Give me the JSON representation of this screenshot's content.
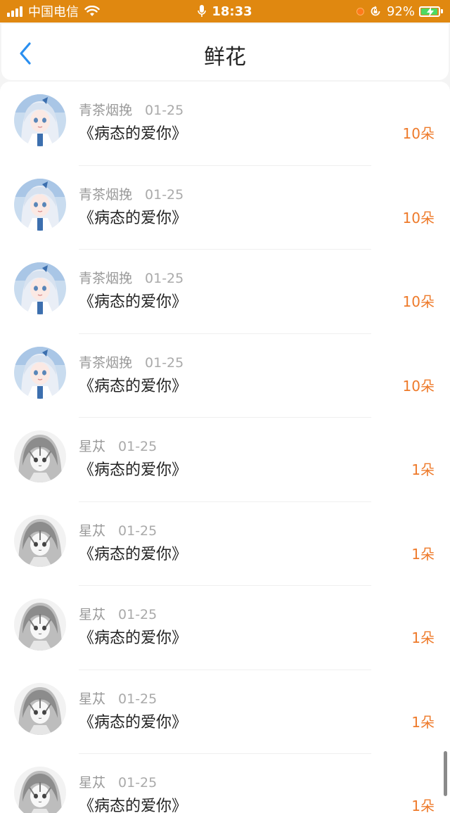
{
  "status_bar": {
    "carrier": "中国电信",
    "time": "18:33",
    "battery": "92%",
    "accent_color": "#e08810"
  },
  "header": {
    "title": "鲜花",
    "back_icon": "chevron-left-icon"
  },
  "items": [
    {
      "user": "青茶烟挽",
      "date": "01-25",
      "title": "《病态的爱你》",
      "amount": "10朵",
      "avatar": "blue-anime-avatar"
    },
    {
      "user": "青茶烟挽",
      "date": "01-25",
      "title": "《病态的爱你》",
      "amount": "10朵",
      "avatar": "blue-anime-avatar"
    },
    {
      "user": "青茶烟挽",
      "date": "01-25",
      "title": "《病态的爱你》",
      "amount": "10朵",
      "avatar": "blue-anime-avatar"
    },
    {
      "user": "青茶烟挽",
      "date": "01-25",
      "title": "《病态的爱你》",
      "amount": "10朵",
      "avatar": "blue-anime-avatar"
    },
    {
      "user": "星苁",
      "date": "01-25",
      "title": "《病态的爱你》",
      "amount": "1朵",
      "avatar": "gray-anime-avatar"
    },
    {
      "user": "星苁",
      "date": "01-25",
      "title": "《病态的爱你》",
      "amount": "1朵",
      "avatar": "gray-anime-avatar"
    },
    {
      "user": "星苁",
      "date": "01-25",
      "title": "《病态的爱你》",
      "amount": "1朵",
      "avatar": "gray-anime-avatar"
    },
    {
      "user": "星苁",
      "date": "01-25",
      "title": "《病态的爱你》",
      "amount": "1朵",
      "avatar": "gray-anime-avatar"
    },
    {
      "user": "星苁",
      "date": "01-25",
      "title": "《病态的爱你》",
      "amount": "1朵",
      "avatar": "gray-anime-avatar"
    }
  ]
}
